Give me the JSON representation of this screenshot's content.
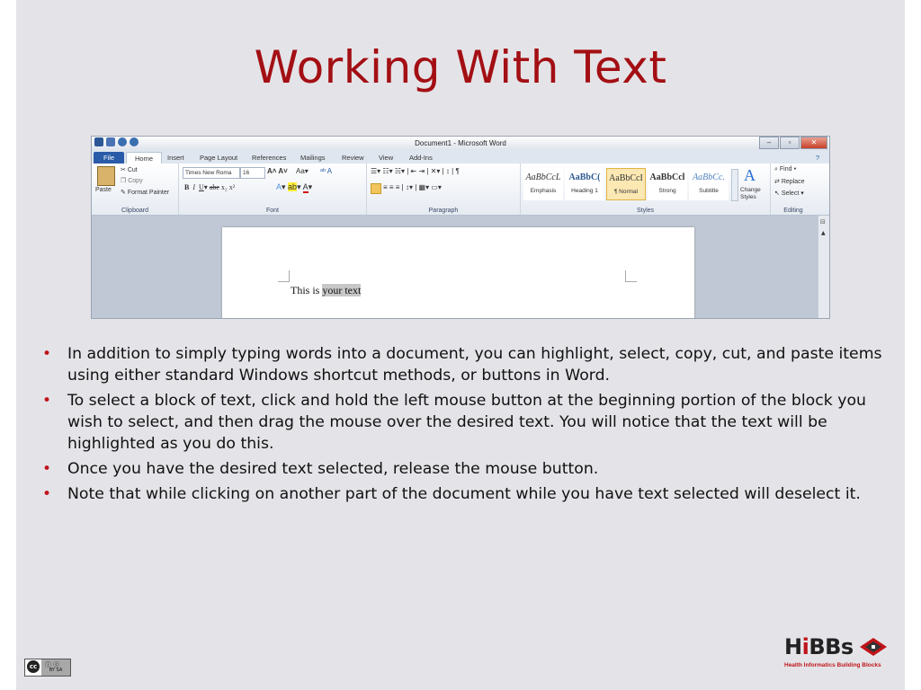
{
  "slide": {
    "title": "Working With Text",
    "bullets": [
      "In addition to simply typing words into a document, you can highlight, select, copy, cut, and paste items using either standard Windows shortcut methods, or buttons in Word.",
      "To select a block of text, click and hold the left mouse button at the beginning portion of the block you wish to select, and then drag the mouse over the desired text.  You will notice that the text will be highlighted as you do this.",
      "Once you have the desired text selected, release the mouse button.",
      "Note that while clicking on another part of the document while you have text selected will deselect it."
    ]
  },
  "word": {
    "window_title": "Document1 - Microsoft Word",
    "tabs": [
      "File",
      "Home",
      "Insert",
      "Page Layout",
      "References",
      "Mailings",
      "Review",
      "View",
      "Add-Ins"
    ],
    "clipboard": {
      "paste": "Paste",
      "cut": "Cut",
      "copy": "Copy",
      "format_painter": "Format Painter",
      "label": "Clipboard"
    },
    "font": {
      "name": "Times New Roma",
      "size": "16",
      "label": "Font"
    },
    "paragraph": {
      "label": "Paragraph"
    },
    "styles": {
      "label": "Styles",
      "items": [
        {
          "sample": "AaBbCcL",
          "name": "Emphasis"
        },
        {
          "sample": "AaBbC(",
          "name": "Heading 1"
        },
        {
          "sample": "AaBbCcI",
          "name": "¶ Normal"
        },
        {
          "sample": "AaBbCcl",
          "name": "Strong"
        },
        {
          "sample": "AaBbCc.",
          "name": "Subtitle"
        }
      ],
      "change_styles": "Change Styles"
    },
    "editing": {
      "find": "Find",
      "replace": "Replace",
      "select": "Select",
      "label": "Editing"
    },
    "document": {
      "plain": "This is ",
      "highlighted": "your text"
    }
  },
  "footer": {
    "license_text": "BY SA",
    "cc_mark": "cc",
    "brand_hi": "H",
    "brand_i": "i",
    "brand_rest": "BBs",
    "tagline": "Health Informatics Building Blocks"
  },
  "colors": {
    "title": "#a30f14",
    "bullet": "#c0141a",
    "slide_bg": "#e4e4e8",
    "file_tab": "#2a5ba8"
  }
}
